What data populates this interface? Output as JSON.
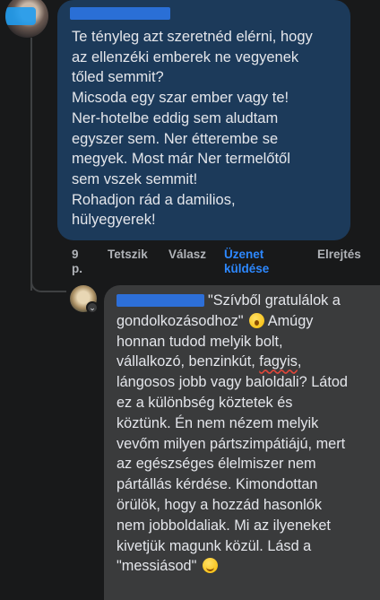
{
  "comment1": {
    "lines": [
      "Te tényleg azt szeretnéd elérni, hogy",
      "az ellenzéki emberek ne vegyenek",
      "tőled semmit?",
      "Micsoda egy szar ember vagy te!",
      "Ner-hotelbe eddig sem aludtam",
      "egyszer sem. Ner étterembe se",
      "megyek. Most már Ner termelőtől",
      "sem vszek semmit!",
      "Rohadjon rád a damilios,",
      "hülyegyerek!"
    ],
    "actions": {
      "time_line1": "9",
      "time_line2": "p.",
      "like": "Tetszik",
      "reply": "Válasz",
      "message_line1": "Üzenet",
      "message_line2": "küldése",
      "hide": "Elrejtés"
    }
  },
  "comment2": {
    "lines": [
      "\"Szívből gratulálok a",
      "gondolkozásodhoz\"",
      "Amúgy",
      "honnan tudod melyik bolt,",
      "vállalkozó, benzinkút, ",
      "fagyis",
      ",",
      "lángosos jobb vagy baloldali? Látod",
      "ez a különbség köztetek és",
      "köztünk. Én nem nézem melyik",
      "vevőm milyen pártszimpátiájú, mert",
      "az egészséges élelmiszer nem",
      "pártállás kérdése. Kimondottan",
      "örülök, hogy a hozzád hasonlók",
      "nem jobboldaliak. Mi az ilyeneket",
      "kivetjük magunk közül. Lásd a",
      "\"messiásod\""
    ]
  }
}
